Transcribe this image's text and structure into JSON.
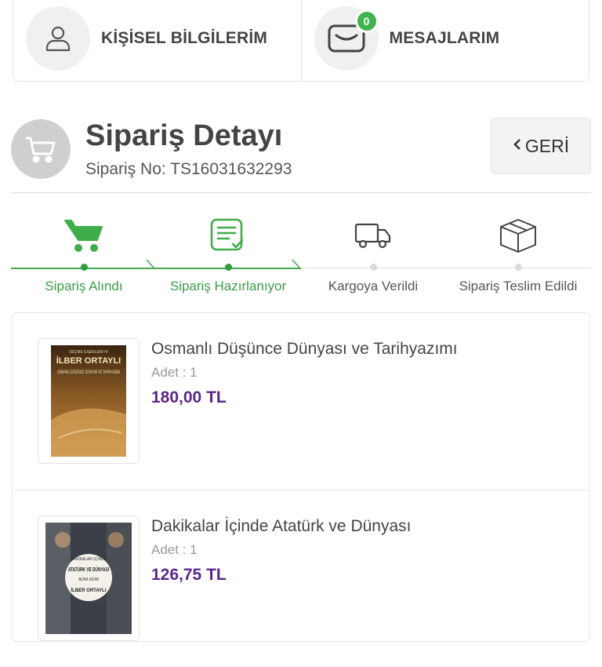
{
  "top_cards": {
    "personal_label": "KİŞİSEL BİLGİLERİM",
    "messages_label": "MESAJLARIM",
    "messages_count": "0"
  },
  "order": {
    "title": "Sipariş Detayı",
    "order_no": "Sipariş No: TS16031632293",
    "back_label": "GERİ"
  },
  "steps": [
    {
      "label": "Sipariş Alındı",
      "icon": "cart-icon",
      "state": "done"
    },
    {
      "label": "Sipariş Hazırlanıyor",
      "icon": "checklist-icon",
      "state": "done"
    },
    {
      "label": "Kargoya Verildi",
      "icon": "truck-icon",
      "state": "pending"
    },
    {
      "label": "Sipariş Teslim Edildi",
      "icon": "box-icon",
      "state": "pending"
    }
  ],
  "products": [
    {
      "name": "Osmanlı Düşünce Dünyası ve Tarihyazımı",
      "qty": "Adet : 1",
      "price": "180,00 TL",
      "cover": {
        "top": "SEÇME ESERLERİ IV",
        "author": "İLBER ORTAYLI",
        "title": "OSMANLI DÜŞÜNCE DÜNYASI VE TARİHYAZIMI"
      }
    },
    {
      "name": "Dakikalar İçinde Atatürk ve Dünyası",
      "qty": "Adet : 1",
      "price": "126,75 TL",
      "cover": {
        "top": "DAKİKALAR İÇİNDE",
        "title": "ATATÜRK VE DÜNYASI",
        "sub": "ADIM ADIM",
        "author": "İLBER ORTAYLI"
      }
    }
  ],
  "colors": {
    "green": "#46a84f",
    "price_purple": "#5b2787"
  }
}
